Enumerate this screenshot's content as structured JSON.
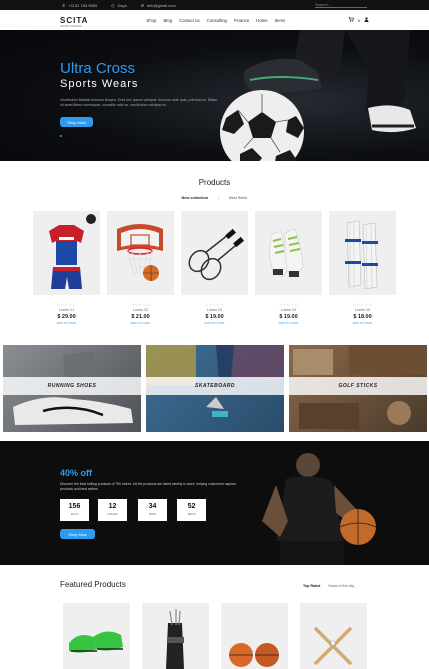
{
  "topbar": {
    "phone": "+1132 783 9569",
    "days": "Days",
    "email": "info@gmail.com",
    "search_placeholder": "Search..."
  },
  "header": {
    "logo": "SCITA",
    "logo_tagline": "SPORTS FASHION",
    "nav": [
      "Shop",
      "Blog",
      "Contact us",
      "Consulting",
      "Finance",
      "Home",
      "Items"
    ],
    "cart_count": "0"
  },
  "hero": {
    "title": "Ultra Cross",
    "subtitle": "Sports Wears",
    "description": "Vestibulum facilisis rhoncus tempor. Duis nec ipsum volutpat, rhoncus ante quis, pulvinar ex. Etiam sit amet libero consequat, convallis odio ac, vestibulum volutpat ex.",
    "button": "Shop Now"
  },
  "products": {
    "title": "Products",
    "tabs": [
      "New collection",
      "Best Seller"
    ],
    "items": [
      {
        "name": "Lorem 21",
        "price": "$ 29.00",
        "cta": "ADD TO CART",
        "stars": "☆☆☆☆☆"
      },
      {
        "name": "Lorem 22",
        "price": "$ 21.00",
        "cta": "ADD TO CART",
        "stars": "☆☆☆☆☆"
      },
      {
        "name": "Lorem 23",
        "price": "$ 19.00",
        "cta": "ADD TO CART",
        "stars": "☆☆☆☆☆"
      },
      {
        "name": "Lorem 24",
        "price": "$ 19.00",
        "cta": "ADD TO CART",
        "stars": "☆☆☆☆☆"
      },
      {
        "name": "Lorem 25",
        "price": "$ 18.00",
        "cta": "ADD TO CART",
        "stars": "☆☆☆☆☆"
      }
    ]
  },
  "categories": [
    {
      "label": "RUNNING SHOES"
    },
    {
      "label": "SKATEBOARD"
    },
    {
      "label": "GOLF STICKS"
    }
  ],
  "promo": {
    "title": "40% off",
    "text": "Discover the best selling products of 790 stores. All the products are listed weekly in store, helping customers capture products and best sellers.",
    "countdown": [
      {
        "num": "156",
        "unit": "DAYS"
      },
      {
        "num": "12",
        "unit": "HOURS"
      },
      {
        "num": "34",
        "unit": "MINS"
      },
      {
        "num": "52",
        "unit": "SECS"
      }
    ],
    "button": "Shop Now"
  },
  "featured": {
    "title": "Featured Products",
    "tabs": [
      "Top Rated",
      "Deals of the day"
    ]
  },
  "colors": {
    "accent": "#2d9cf0",
    "dark": "#0d0d0d"
  }
}
